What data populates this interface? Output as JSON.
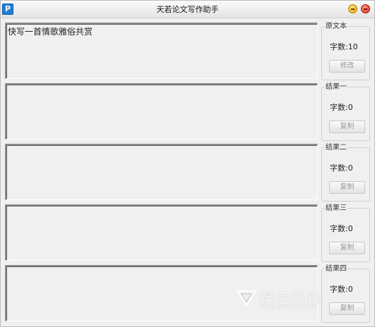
{
  "window": {
    "title": "天若论文写作助手",
    "icon_letter": "P"
  },
  "main": {
    "original_text": "快写一首情歌雅俗共赏",
    "result1_text": "",
    "result2_text": "",
    "result3_text": "",
    "result4_text": ""
  },
  "panels": [
    {
      "legend": "原文本",
      "count": "字数:10",
      "button": "修改"
    },
    {
      "legend": "结果一",
      "count": "字数:0",
      "button": "复制"
    },
    {
      "legend": "结果二",
      "count": "字数:0",
      "button": "复制"
    },
    {
      "legend": "结果三",
      "count": "字数:0",
      "button": "复制"
    },
    {
      "legend": "结果四",
      "count": "字数:0",
      "button": "复制"
    }
  ],
  "watermark": {
    "text": "绿色先锋",
    "url": "www.greenxf.com"
  },
  "colors": {
    "title_bg": "#e9e9e9",
    "window_bg": "#f0f0f0",
    "minimize": "#f0b400",
    "close": "#e0301e"
  }
}
